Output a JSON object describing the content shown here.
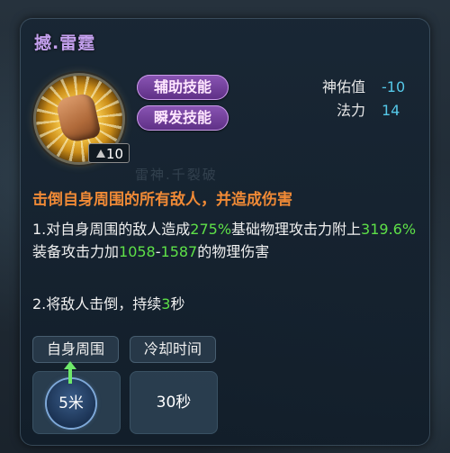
{
  "skill": {
    "title": "撼.雷霆",
    "level": "10",
    "icon": "fist-lightning-icon",
    "tags": [
      "辅助技能",
      "瞬发技能"
    ]
  },
  "stats": {
    "rows": [
      {
        "label": "神佑值",
        "value": "-10"
      },
      {
        "label": "法力",
        "value": "14"
      }
    ]
  },
  "background": {
    "ghost_text": "雷神.千裂破"
  },
  "description": {
    "headline": "击倒自身周围的所有敌人，并造成伤害",
    "line1": {
      "p1": "1.对自身周围的敌人造成",
      "v1": "275%",
      "p2": "基础物理攻击力附上",
      "v2": "319.6%",
      "p3": "装备攻击力加",
      "v3": "1058",
      "dash": "-",
      "v4": "1587",
      "p4": "的物理伤害"
    },
    "line2": {
      "p1": "2.将敌人击倒，持续",
      "v1": "3",
      "p2": "秒"
    }
  },
  "meta": {
    "range_label": "自身周围",
    "cooldown_label": "冷却时间",
    "range_value": "5米",
    "cooldown_value": "30秒"
  },
  "colors": {
    "title": "#c4a0ee",
    "tag_bg": "#6e3a98",
    "stat_value": "#55c8e8",
    "headline": "#f08a36",
    "highlight_green": "#5ee048"
  }
}
